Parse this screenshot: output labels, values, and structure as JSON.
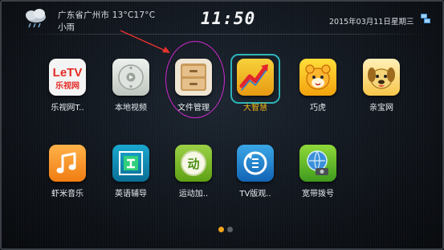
{
  "status_bar": {
    "location": "广东省广州市 13°C17°C",
    "condition": "小雨",
    "time": "11:50",
    "date": "2015年03月11日",
    "weekday": "星期三"
  },
  "apps_row1": [
    {
      "label": "乐视网T..",
      "icon": "letv-icon",
      "logo_text": "LeTV",
      "logo_sub": "乐视网"
    },
    {
      "label": "本地视频",
      "icon": "local-video-icon"
    },
    {
      "label": "文件管理",
      "icon": "file-manager-icon"
    },
    {
      "label": "大智慧",
      "icon": "dazhihui-icon",
      "focused": true
    },
    {
      "label": "巧虎",
      "icon": "qiaohu-icon"
    },
    {
      "label": "亲宝网",
      "icon": "qinbao-icon"
    }
  ],
  "apps_row2": [
    {
      "label": "虾米音乐",
      "icon": "xiami-music-icon"
    },
    {
      "label": "英语辅导",
      "icon": "english-tutor-icon"
    },
    {
      "label": "运动加..",
      "icon": "sports-icon",
      "logo_text": "动"
    },
    {
      "label": "TV版观..",
      "icon": "tv-viewer-icon"
    },
    {
      "label": "宽带拨号",
      "icon": "broadband-dial-icon"
    }
  ],
  "pagination": {
    "current_page": 1,
    "total_pages": 2,
    "active_color": "#f2a51a",
    "inactive_color": "#5a6068"
  },
  "annotation": {
    "ring_color": "#d128d1",
    "arrow_color": "#e8322e"
  },
  "focus_color": "#2db3b8"
}
